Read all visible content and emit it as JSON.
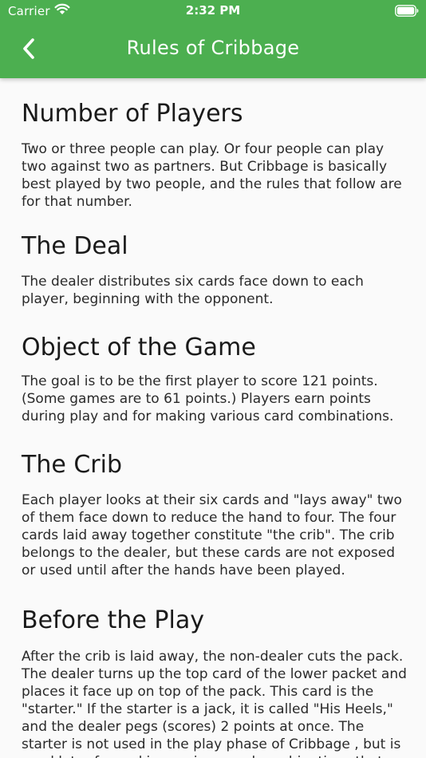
{
  "status_bar": {
    "carrier": "Carrier",
    "time": "2:32 PM"
  },
  "nav": {
    "title": "Rules of Cribbage",
    "back_icon": "chevron-left-icon"
  },
  "colors": {
    "header_bg": "#4caf50",
    "header_text": "#ffffff",
    "page_bg": "#fafafa",
    "body_text": "#212121"
  },
  "sections": [
    {
      "heading": "Number of Players",
      "body": "Two or three people can play. Or four people can play two against two as partners. But Cribbage is basically best played by two people, and the rules that follow are for that number."
    },
    {
      "heading": "The Deal",
      "body": "The dealer distributes six cards face down to each player, beginning with the opponent."
    },
    {
      "heading": "Object of the Game",
      "body": "The goal is to be the first player to score 121 points. (Some games are to 61 points.) Players earn points during play and for making various card combinations."
    },
    {
      "heading": "The Crib",
      "body": "Each player looks at their six cards and \"lays away\" two of them face down to reduce the hand to four. The four cards laid away together constitute \"the crib\". The crib belongs to the dealer, but these cards are not exposed or used until after the hands have been played."
    },
    {
      "heading": "Before the Play",
      "body": "After the crib is laid away, the non-dealer cuts the pack. The dealer turns up the top card of the lower packet and places it face up on top of the pack. This card is the \"starter.\" If the starter is a jack, it is called \"His Heels,\" and the dealer pegs (scores) 2 points at once. The starter is not used in the play phase of Cribbage , but is used later for making various card combinations that score points."
    }
  ]
}
